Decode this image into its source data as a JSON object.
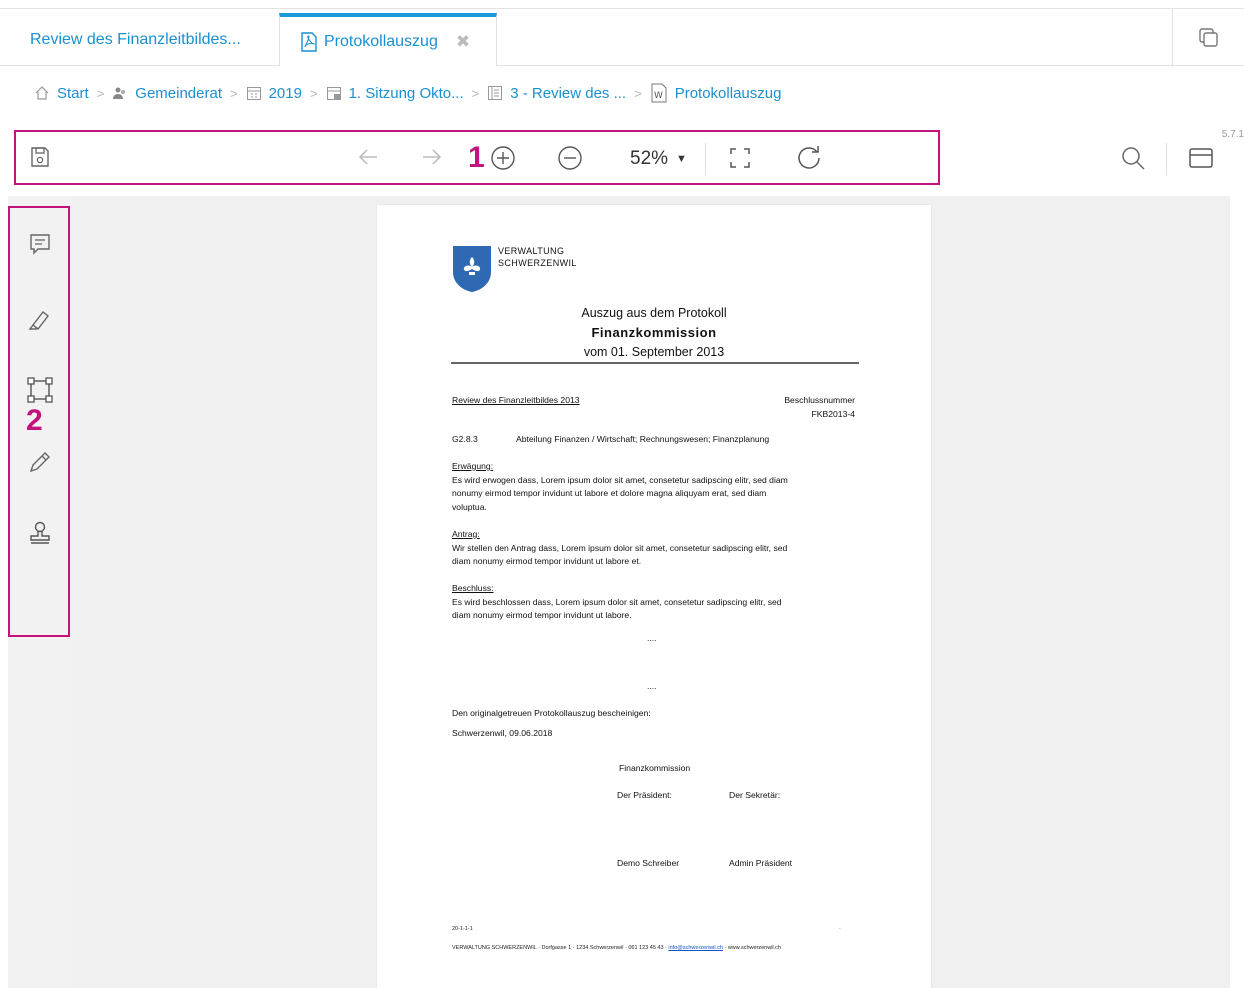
{
  "tabs": {
    "tab1_label": "Review des Finanzleitbildes...",
    "tab2_label": "Protokollauszug",
    "close_glyph": "✖"
  },
  "breadcrumb": {
    "items": [
      "Start",
      "Gemeinderat",
      "2019",
      "1. Sitzung Okto...",
      "3 - Review des ...",
      "Protokollauszug"
    ],
    "separator": ">"
  },
  "toolbar": {
    "zoom": "52%",
    "version": "5.7.1",
    "marker1": "1"
  },
  "sidebar": {
    "marker2": "2"
  },
  "document": {
    "org_line1": "VERWALTUNG",
    "org_line2": "SCHWERZENWIL",
    "title_line1": "Auszug aus dem Protokoll",
    "title_line2": "Finanzkommission",
    "title_line3": "vom 01. September 2013",
    "subject": "Review des Finanzleitbildes 2013",
    "decision_label": "Beschlussnummer",
    "decision_number": "FKB2013-4",
    "code": "G2.8.3",
    "code_text": "Abteilung Finanzen / Wirtschaft; Rechnungswesen; Finanzplanung",
    "s1_head": "Erwägung:",
    "s1_l1": "Es wird erwogen dass, Lorem ipsum dolor sit amet, consetetur sadipscing elitr, sed diam",
    "s1_l2": "nonumy eirmod tempor invidunt ut labore et dolore magna aliquyam erat, sed diam",
    "s1_l3": "voluptua.",
    "s2_head": "Antrag:",
    "s2_l1": "Wir stellen den Antrag dass, Lorem ipsum dolor sit amet, consetetur sadipscing elitr, sed",
    "s2_l2": "diam nonumy eirmod tempor invidunt ut labore et.",
    "s3_head": "Beschluss:",
    "s3_l1": "Es wird beschlossen dass, Lorem ipsum dolor sit amet, consetetur sadipscing elitr, sed",
    "s3_l2": "diam nonumy eirmod tempor invidunt ut labore.",
    "dots1": "....",
    "dots2": "....",
    "certify": "Den originalgetreuen Protokollauszug bescheinigen:",
    "place_date": "Schwerzenwil, 09.06.2018",
    "committee": "Finanzkommission",
    "president_label": "Der Präsident:",
    "secretary_label": "Der Sekretär:",
    "sign1": "Demo Schreiber",
    "sign2": "Admin Präsident",
    "footer_small": "20-1-1-1",
    "footer_dot": "·",
    "footer_left": "VERWALTUNG SCHWERZENWIL · Dorfgasse 1 · 1234 Schwerzenwil · 061 123 45 43 ·",
    "footer_link": "info@schwerzenwil.ch",
    "footer_right": "· www.schwerzenwil.ch"
  }
}
